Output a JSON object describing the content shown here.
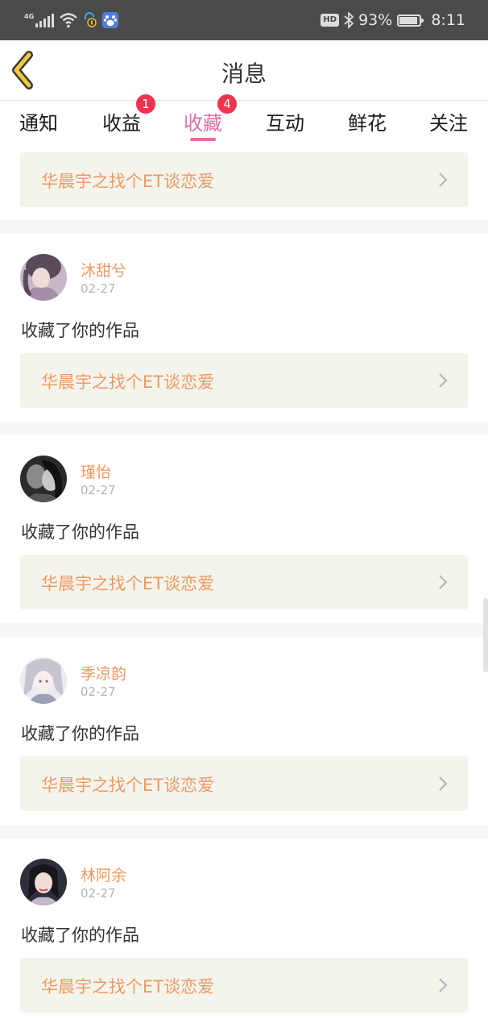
{
  "status_bar": {
    "network": "4G",
    "hd": "HD",
    "battery_percent": "93%",
    "battery_level": 0.93,
    "time": "8:11",
    "icons": [
      "signal-icon",
      "wifi-icon",
      "vpn-icon",
      "baidu-icon",
      "bluetooth-icon",
      "battery-icon"
    ]
  },
  "header": {
    "title": "消息",
    "back_icon": "chevron-left-icon"
  },
  "tabs": [
    {
      "label": "通知",
      "badge": ""
    },
    {
      "label": "收益",
      "badge": "1"
    },
    {
      "label": "收藏",
      "badge": "4",
      "active": true
    },
    {
      "label": "互动",
      "badge": ""
    },
    {
      "label": "鲜花",
      "badge": ""
    },
    {
      "label": "关注",
      "badge": ""
    }
  ],
  "feed": {
    "top_partial": {
      "work_title": "华晨宇之找个ET谈恋爱"
    },
    "items": [
      {
        "username": "沐甜兮",
        "date": "02-27",
        "action": "收藏了你的作品",
        "work_title": "华晨宇之找个ET谈恋爱"
      },
      {
        "username": "瑾怡",
        "date": "02-27",
        "action": "收藏了你的作品",
        "work_title": "华晨宇之找个ET谈恋爱"
      },
      {
        "username": "季凉韵",
        "date": "02-27",
        "action": "收藏了你的作品",
        "work_title": "华晨宇之找个ET谈恋爱"
      },
      {
        "username": "林阿余",
        "date": "02-27",
        "action": "收藏了你的作品",
        "work_title": "华晨宇之找个ET谈恋爱"
      }
    ]
  },
  "colors": {
    "accent_pink": "#e06ea4",
    "badge_red": "#f0334f",
    "username_orange": "#ee9a62",
    "back_arrow_yellow": "#f5c842"
  }
}
